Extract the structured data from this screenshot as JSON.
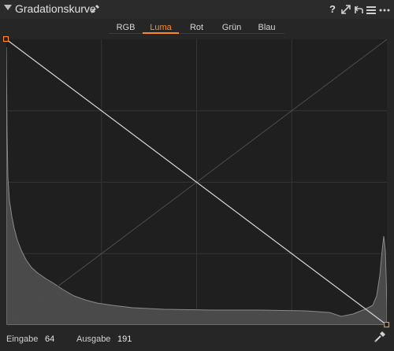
{
  "panel": {
    "title": "Gradationskurve",
    "help_label": "?"
  },
  "tabs": [
    {
      "label": "RGB",
      "active": false
    },
    {
      "label": "Luma",
      "active": true
    },
    {
      "label": "Rot",
      "active": false
    },
    {
      "label": "Grün",
      "active": false
    },
    {
      "label": "Blau",
      "active": false
    }
  ],
  "footer": {
    "input_label": "Eingabe",
    "input_value": "64",
    "output_label": "Ausgabe",
    "output_value": "191"
  },
  "colors": {
    "accent": "#ff8a22",
    "background": "#262626",
    "plot_background": "#1f1f1f",
    "histogram": "#4a4a4a",
    "curve": "#d8d8d8"
  }
}
